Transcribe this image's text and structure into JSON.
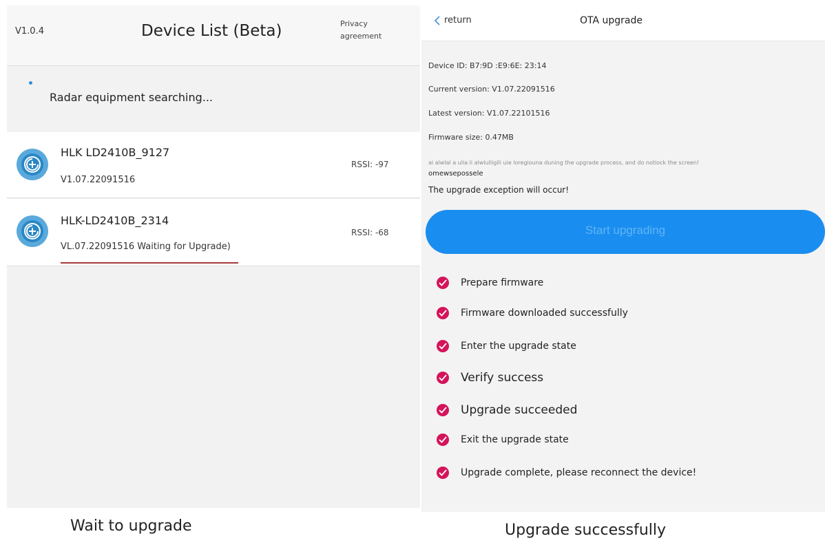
{
  "left": {
    "version": "V1.0.4",
    "title": "Device List (Beta)",
    "privacy_line1": "Privacy",
    "privacy_line2": "agreement",
    "search_status": "Radar equipment searching...",
    "devices": [
      {
        "name": "HLK LD2410B_9127",
        "version": "V1.07.22091516",
        "rssi": "RSSI: -97"
      },
      {
        "name": "HLK-LD2410B_2314",
        "version": "VL.07.22091516 Waiting for Upgrade)",
        "rssi": "RSSI: -68"
      }
    ],
    "caption": "Wait to upgrade"
  },
  "right": {
    "back_label": "return",
    "title": "OTA upgrade",
    "device_id": "Device ID: B7:9D :E9:6E: 23:14",
    "current_version": "Current version: V1.07.22091516",
    "latest_version": "Latest version: V1.07.22101516",
    "firmware_size": "Firmware size: 0.47MB",
    "notice_faded": "ai alwlal a ulia li alwlulligili uie loregiouna duning the upgrade process, and do notiock the screen!",
    "notice_cont": "omewsepossele",
    "notice_warning": "The upgrade exception will occur!",
    "start_button": "Start upgrading",
    "steps": [
      "Prepare firmware",
      "Firmware downloaded successfully",
      "Enter the upgrade state",
      "Verify success",
      "Upgrade succeeded",
      "Exit the upgrade state",
      "Upgrade complete, please reconnect the device!"
    ],
    "caption": "Upgrade successfully"
  },
  "colors": {
    "accent_blue": "#1a8ef0",
    "step_check": "#d4145a",
    "progress_red": "#a33a3a"
  },
  "icons": {
    "device": "radar-device-icon",
    "back": "chevron-left-icon",
    "step": "check-circle-icon"
  }
}
